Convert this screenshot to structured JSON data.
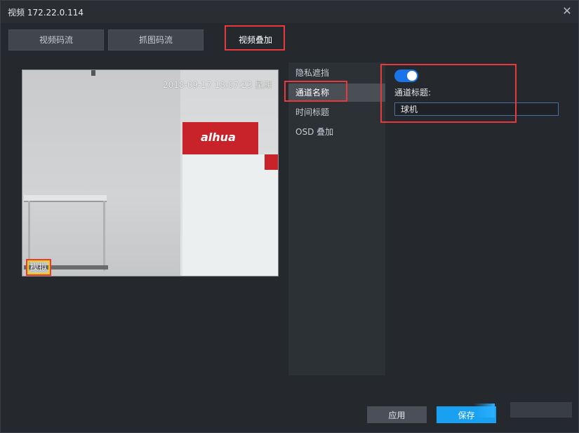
{
  "window": {
    "title": "视频 172.22.0.114"
  },
  "tabs": [
    {
      "label": "视频码流"
    },
    {
      "label": "抓图码流"
    },
    {
      "label": "视频叠加"
    }
  ],
  "video": {
    "osd_time": "2018-09-17 18:07:23 星期",
    "osd_channel": "模拟",
    "brand": "alhua"
  },
  "menu": {
    "items": [
      {
        "label": "隐私遮挡"
      },
      {
        "label": "通道名称"
      },
      {
        "label": "时间标题"
      },
      {
        "label": "OSD 叠加"
      }
    ]
  },
  "settings": {
    "toggle_on": true,
    "channel_title_label": "通道标题:",
    "channel_title_value": "球机"
  },
  "buttons": {
    "apply": "应用",
    "save": "保存"
  },
  "colors": {
    "accent": "#1a73e8",
    "save": "#19a0f0",
    "highlight": "#e8393f"
  }
}
